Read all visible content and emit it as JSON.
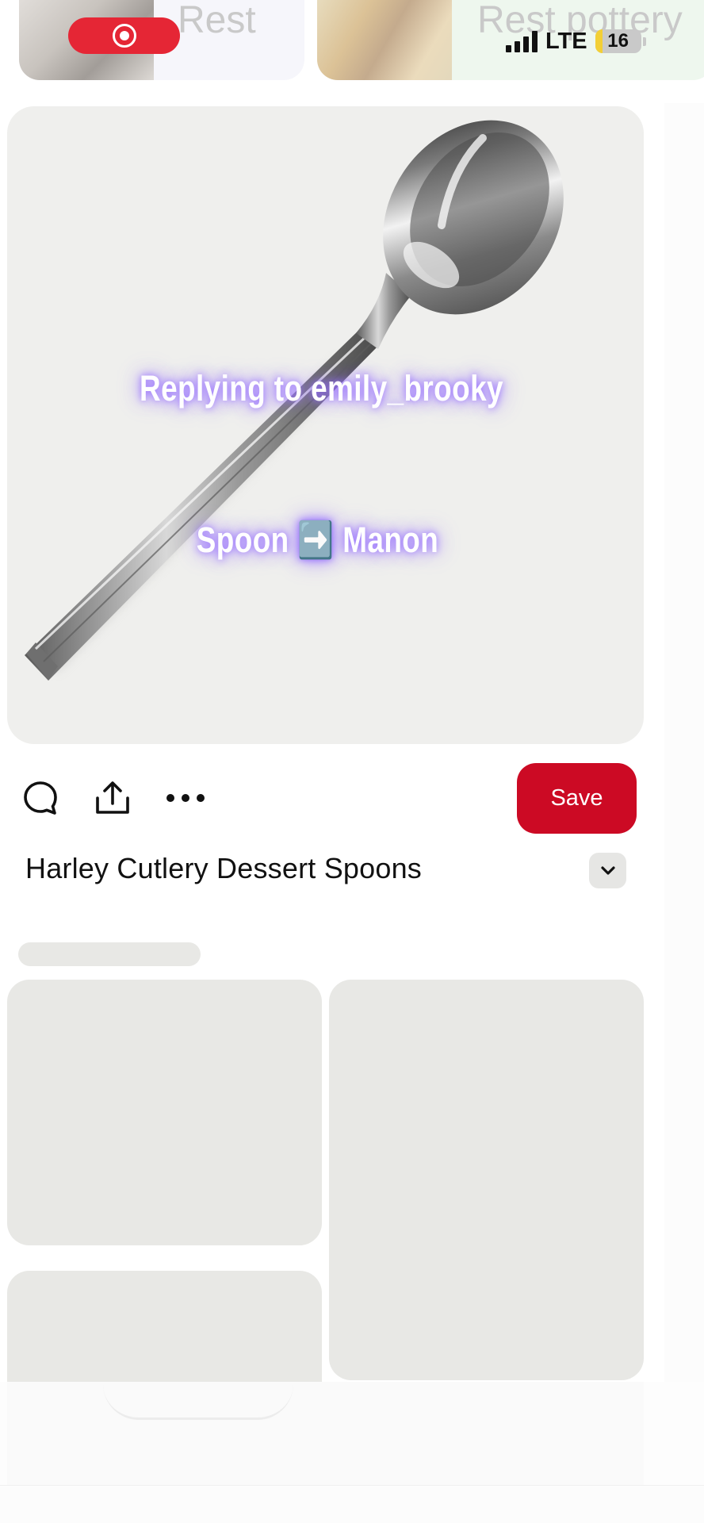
{
  "related_cards": [
    {
      "label": "Rest"
    },
    {
      "label": "Rest pottery"
    }
  ],
  "status_bar": {
    "network": "LTE",
    "battery_level": "16",
    "battery_fraction": 0.16,
    "recording": true
  },
  "pin": {
    "image_icon": "spoon-image",
    "caption_lines": [
      "Replying to emily_brooky",
      "Spoon ➡️ Manon"
    ],
    "title": "Harley Cutlery Dessert Spoons"
  },
  "actions": {
    "comment_icon": "comment-icon",
    "share_icon": "share-icon",
    "more_icon": "more-icon",
    "save_label": "Save"
  },
  "colors": {
    "save_button": "#cc0a24",
    "record_pill": "#e52635",
    "skeleton": "#e8e8e5",
    "caption_glow": "#966eff"
  }
}
